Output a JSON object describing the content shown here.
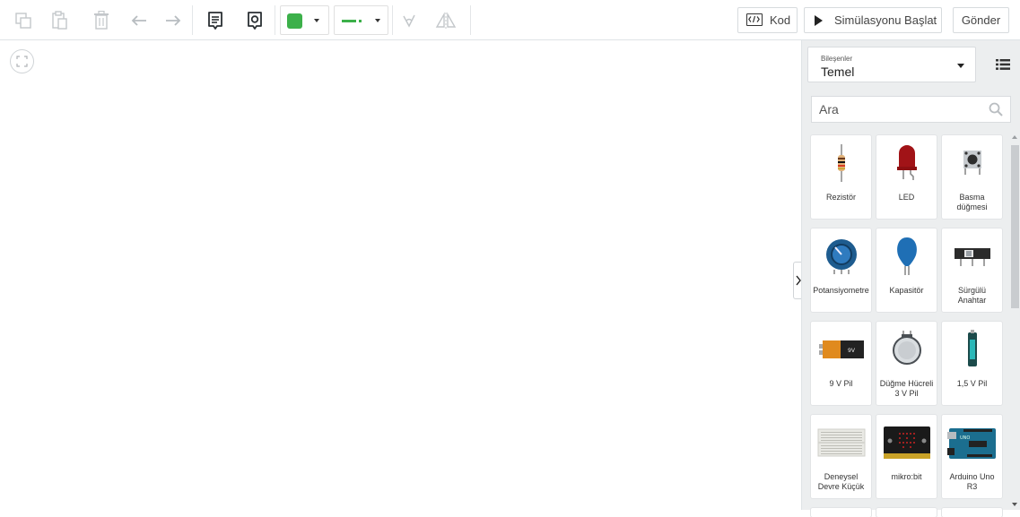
{
  "toolbar": {
    "icons": [
      "copy-icon",
      "paste-icon",
      "trash-icon",
      "undo-icon",
      "redo-icon",
      "notes-icon",
      "annotation-icon"
    ],
    "fill_color": "#3cb04a",
    "line_color": "#3cb04a",
    "code_label": "Kod",
    "simulate_label": "Simülasyonu Başlat",
    "send_label": "Gönder"
  },
  "panel": {
    "category_caption": "Bileşenler",
    "category_value": "Temel",
    "search_placeholder": "Ara",
    "components": [
      {
        "label": "Rezistör",
        "icon": "resistor-icon"
      },
      {
        "label": "LED",
        "icon": "led-icon"
      },
      {
        "label": "Basma\ndüğmesi",
        "icon": "pushbutton-icon"
      },
      {
        "label": "Potansiyometre",
        "icon": "potentiometer-icon"
      },
      {
        "label": "Kapasitör",
        "icon": "capacitor-icon"
      },
      {
        "label": "Sürgülü\nAnahtar",
        "icon": "slide-switch-icon"
      },
      {
        "label": "9 V Pil",
        "icon": "battery-9v-icon"
      },
      {
        "label": "Düğme Hücreli\n3 V Pil",
        "icon": "coin-cell-icon"
      },
      {
        "label": "1,5 V Pil",
        "icon": "battery-aa-icon"
      },
      {
        "label": "Deneysel\nDevre Küçük",
        "icon": "breadboard-icon"
      },
      {
        "label": "mikro:bit",
        "icon": "microbit-icon"
      },
      {
        "label": "Arduino Uno\nR3",
        "icon": "arduino-icon"
      }
    ]
  }
}
